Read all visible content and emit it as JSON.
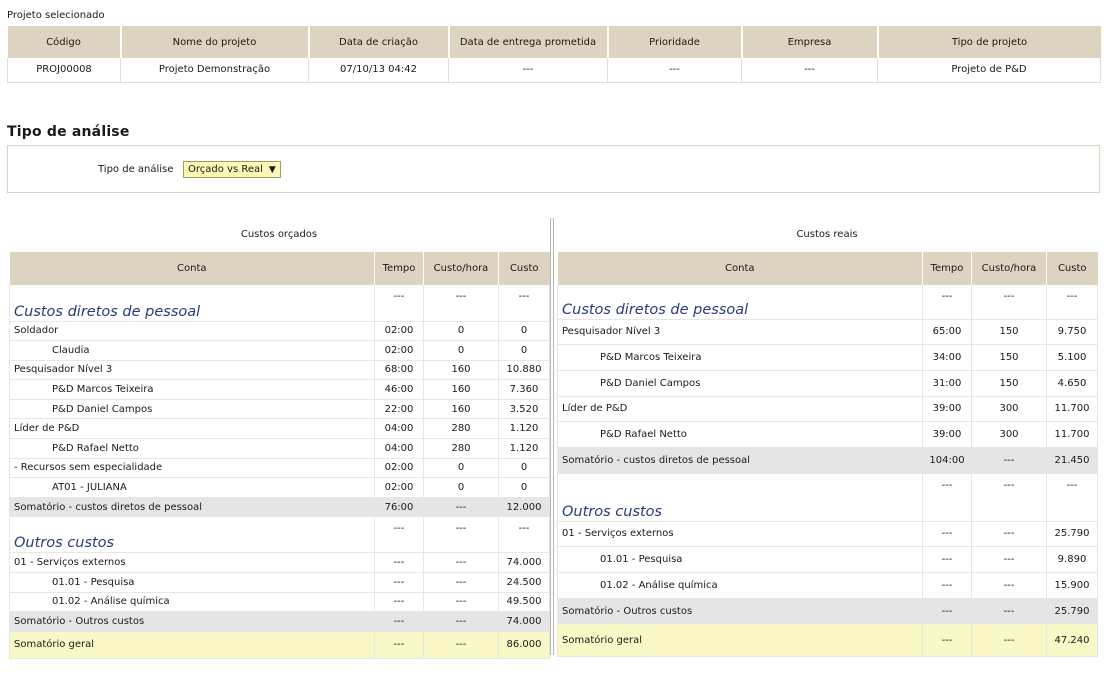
{
  "project_section": {
    "label": "Projeto selecionado",
    "headers": [
      "Código",
      "Nome do projeto",
      "Data de criação",
      "Data de entrega prometida",
      "Prioridade",
      "Empresa",
      "Tipo de projeto"
    ],
    "row": [
      "PROJ00008",
      "Projeto Demonstração",
      "07/10/13 04:42",
      "---",
      "---",
      "---",
      "Projeto de P&D"
    ]
  },
  "analysis": {
    "title": "Tipo de análise",
    "field_label": "Tipo de análise",
    "selected": "Orçado vs Real",
    "arrow": "▼"
  },
  "budgeted": {
    "title": "Custos orçados",
    "headers": [
      "Conta",
      "Tempo",
      "Custo/hora",
      "Custo"
    ],
    "rows": [
      {
        "type": "group",
        "cells": [
          "Custos diretos de pessoal",
          "---",
          "---",
          "---"
        ]
      },
      {
        "type": "item",
        "cells": [
          "Soldador",
          "02:00",
          "0",
          "0"
        ]
      },
      {
        "type": "sub",
        "cells": [
          "Claudia",
          "02:00",
          "0",
          "0"
        ]
      },
      {
        "type": "item",
        "cells": [
          "Pesquisador Nível 3",
          "68:00",
          "160",
          "10.880"
        ]
      },
      {
        "type": "sub",
        "cells": [
          "P&D Marcos Teixeira",
          "46:00",
          "160",
          "7.360"
        ]
      },
      {
        "type": "sub",
        "cells": [
          "P&D Daniel Campos",
          "22:00",
          "160",
          "3.520"
        ]
      },
      {
        "type": "item",
        "cells": [
          "Líder de P&D",
          "04:00",
          "280",
          "1.120"
        ]
      },
      {
        "type": "sub",
        "cells": [
          "P&D Rafael Netto",
          "04:00",
          "280",
          "1.120"
        ]
      },
      {
        "type": "item",
        "cells": [
          "- Recursos sem especialidade",
          "02:00",
          "0",
          "0"
        ]
      },
      {
        "type": "sub",
        "cells": [
          "AT01 - JULIANA",
          "02:00",
          "0",
          "0"
        ]
      },
      {
        "type": "sum",
        "cells": [
          "Somatório - custos diretos de pessoal",
          "76:00",
          "---",
          "12.000"
        ]
      },
      {
        "type": "group",
        "cells": [
          "Outros custos",
          "---",
          "---",
          "---"
        ]
      },
      {
        "type": "item",
        "cells": [
          "01 - Serviços externos",
          "---",
          "---",
          "74.000"
        ]
      },
      {
        "type": "sub",
        "cells": [
          "01.01 - Pesquisa",
          "---",
          "---",
          "24.500"
        ]
      },
      {
        "type": "sub",
        "cells": [
          "01.02 - Análise química",
          "---",
          "---",
          "49.500"
        ]
      },
      {
        "type": "sum",
        "cells": [
          "Somatório - Outros custos",
          "---",
          "---",
          "74.000"
        ]
      },
      {
        "type": "total",
        "cells": [
          "Somatório geral",
          "---",
          "---",
          "86.000"
        ]
      }
    ]
  },
  "actual": {
    "title": "Custos reais",
    "headers": [
      "Conta",
      "Tempo",
      "Custo/hora",
      "Custo"
    ],
    "rows": [
      {
        "type": "group",
        "cells": [
          "Custos diretos de pessoal",
          "---",
          "---",
          "---"
        ]
      },
      {
        "type": "item",
        "cells": [
          "Pesquisador Nível 3",
          "65:00",
          "150",
          "9.750"
        ]
      },
      {
        "type": "sub",
        "cells": [
          "P&D Marcos Teixeira",
          "34:00",
          "150",
          "5.100"
        ]
      },
      {
        "type": "sub",
        "cells": [
          "P&D Daniel Campos",
          "31:00",
          "150",
          "4.650"
        ]
      },
      {
        "type": "item",
        "cells": [
          "Líder de P&D",
          "39:00",
          "300",
          "11.700"
        ]
      },
      {
        "type": "sub",
        "cells": [
          "P&D Rafael Netto",
          "39:00",
          "300",
          "11.700"
        ]
      },
      {
        "type": "sum",
        "cells": [
          "Somatório - custos diretos de pessoal",
          "104:00",
          "---",
          "21.450"
        ]
      },
      {
        "type": "group",
        "cells": [
          "Outros custos",
          "---",
          "---",
          "---"
        ]
      },
      {
        "type": "item",
        "cells": [
          "01 - Serviços externos",
          "---",
          "---",
          "25.790"
        ]
      },
      {
        "type": "sub",
        "cells": [
          "01.01 - Pesquisa",
          "---",
          "---",
          "9.890"
        ]
      },
      {
        "type": "sub",
        "cells": [
          "01.02 - Análise química",
          "---",
          "---",
          "15.900"
        ]
      },
      {
        "type": "sum",
        "cells": [
          "Somatório - Outros custos",
          "---",
          "---",
          "25.790"
        ]
      },
      {
        "type": "total",
        "cells": [
          "Somatório geral",
          "---",
          "---",
          "47.240"
        ]
      }
    ]
  }
}
